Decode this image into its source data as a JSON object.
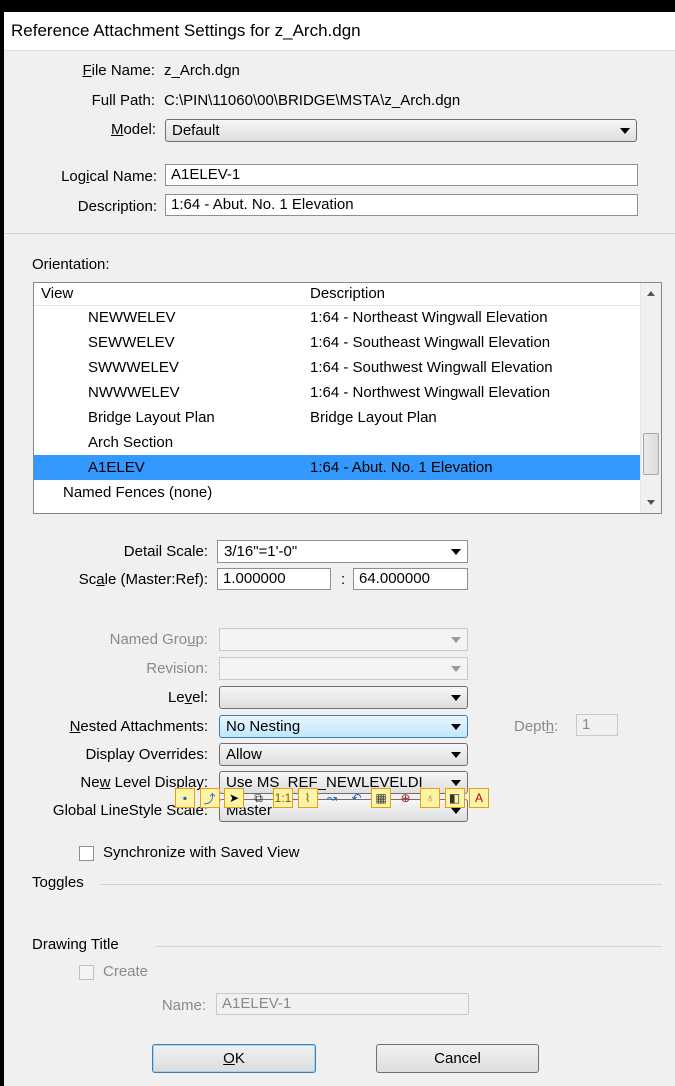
{
  "window": {
    "title": "Reference Attachment Settings for z_Arch.dgn"
  },
  "file": {
    "file_name_label": "File Name:",
    "file_name": "z_Arch.dgn",
    "full_path_label": "Full Path:",
    "full_path": "C:\\PIN\\11060\\00\\BRIDGE\\MSTA\\z_Arch.dgn",
    "model_label": "Model:",
    "model": "Default"
  },
  "naming": {
    "logical_name_label": "Logical Name:",
    "logical_name": "A1ELEV-1",
    "description_label": "Description:",
    "description": "1:64 - Abut. No. 1 Elevation"
  },
  "orientation": {
    "label": "Orientation:",
    "columns": [
      "View",
      "Description"
    ],
    "rows": [
      {
        "view": "NEWWELEV",
        "description": "1:64 - Northeast Wingwall Elevation",
        "indent": true,
        "selected": false
      },
      {
        "view": "SEWWELEV",
        "description": "1:64 - Southeast Wingwall Elevation",
        "indent": true,
        "selected": false
      },
      {
        "view": "SWWWELEV",
        "description": "1:64 - Southwest Wingwall Elevation",
        "indent": true,
        "selected": false
      },
      {
        "view": "NWWWELEV",
        "description": "1:64 - Northwest Wingwall Elevation",
        "indent": true,
        "selected": false
      },
      {
        "view": "Bridge Layout Plan",
        "description": "Bridge Layout Plan",
        "indent": true,
        "selected": false
      },
      {
        "view": "Arch Section",
        "description": "",
        "indent": true,
        "selected": false
      },
      {
        "view": "A1ELEV",
        "description": "1:64 - Abut. No. 1 Elevation",
        "indent": true,
        "selected": true
      },
      {
        "view": "Named Fences (none)",
        "description": "",
        "indent": false,
        "selected": false
      }
    ]
  },
  "scale": {
    "detail_scale_label": "Detail Scale:",
    "detail_scale": "3/16\"=1'-0\"",
    "master_ref_label": "Scale (Master:Ref):",
    "master": "1.000000",
    "colon": ":",
    "ref": "64.000000"
  },
  "attach": {
    "named_group_label": "Named Group:",
    "named_group": "",
    "revision_label": "Revision:",
    "revision": "",
    "level_label": "Level:",
    "level": "",
    "nested_label": "Nested Attachments:",
    "nested": "No Nesting",
    "depth_label": "Depth:",
    "depth": "1",
    "display_overrides_label": "Display Overrides:",
    "display_overrides": "Allow",
    "new_level_display_label": "New Level Display:",
    "new_level_display": "Use MS_REF_NEWLEVELDI",
    "global_linestyle_label": "Global LineStyle Scale:",
    "global_linestyle": "Master",
    "sync_label": "Synchronize with Saved View",
    "sync_checked": false
  },
  "toggles": {
    "label": "Toggles",
    "items": [
      {
        "icon": "display-icon",
        "on": true
      },
      {
        "icon": "snap-icon",
        "on": true
      },
      {
        "icon": "locate-icon",
        "on": true
      },
      {
        "icon": "georeference-icon",
        "on": false
      },
      {
        "icon": "true-scale-icon",
        "on": true
      },
      {
        "icon": "scale-line-styles-icon",
        "on": true
      },
      {
        "icon": "ignore-attachment-icon",
        "on": false
      },
      {
        "icon": "treat-as-element-icon",
        "on": false
      },
      {
        "icon": "raster-icon",
        "on": true
      },
      {
        "icon": "annotation-icon",
        "on": false
      },
      {
        "icon": "lights-icon",
        "on": true
      },
      {
        "icon": "clip-icon",
        "on": true
      },
      {
        "icon": "level-display-icon",
        "on": true
      }
    ]
  },
  "drawing_title": {
    "label": "Drawing Title",
    "create_label": "Create",
    "create_checked": false,
    "name_label": "Name:",
    "name": "A1ELEV-1"
  },
  "buttons": {
    "ok": "OK",
    "cancel": "Cancel"
  },
  "colors": {
    "selection": "#3399ff",
    "toggle_on": "#fff3a8",
    "dialog_bg": "#f0f0f0"
  }
}
